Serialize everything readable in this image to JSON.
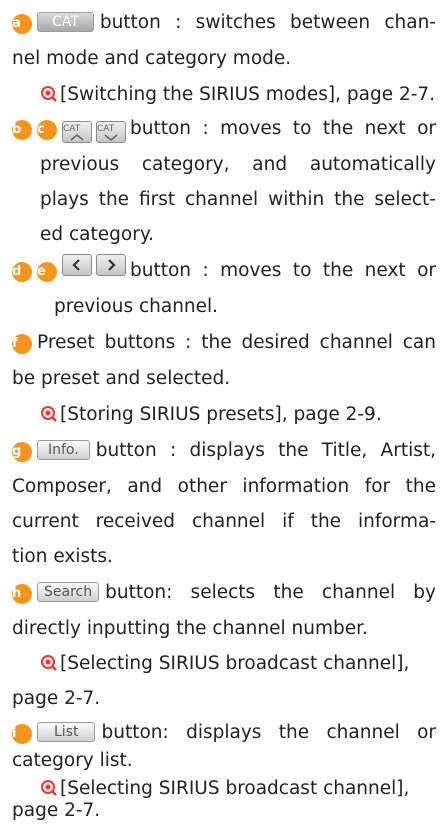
{
  "colors": {
    "bullet": "#f3941e",
    "text": "#231f20"
  },
  "items": {
    "a": {
      "bullet": "a",
      "button": "CAT",
      "l1": "button : switches between chan-",
      "l2": "nel mode and category mode.",
      "ref": "[Switching the SIRIUS modes], page 2-7."
    },
    "bc": {
      "bullet1": "b",
      "bullet2": "c",
      "icon1": "CAT",
      "icon2": "CAT",
      "l1": "button : moves to the next or",
      "l2": "previous category, and automatically",
      "l3": "plays the first channel within the select-",
      "l4": "ed category."
    },
    "de": {
      "bullet1": "d",
      "bullet2": "e",
      "l1": "button : moves to the next or",
      "l2": "previous channel."
    },
    "f": {
      "bullet": "f",
      "l1": "Preset buttons : the desired channel can",
      "l2": "be preset and selected.",
      "ref": "[Storing SIRIUS presets], page 2-9."
    },
    "g": {
      "bullet": "g",
      "button": "Info.",
      "l1": "button : displays the Title, Artist,",
      "l2": "Composer, and other information for the",
      "l3": "current received channel if the informa-",
      "l4": "tion exists."
    },
    "h": {
      "bullet": "h",
      "button": "Search",
      "l1": "button: selects the channel by",
      "l2": "directly inputting the channel number.",
      "ref": "[Selecting SIRIUS broadcast channel],",
      "ref2": "page 2-7."
    },
    "i": {
      "bullet": "i",
      "button": "List",
      "l1": "button: displays the channel or",
      "l2": "category list.",
      "ref": "[Selecting SIRIUS broadcast channel],",
      "ref2": "page 2-7."
    }
  }
}
